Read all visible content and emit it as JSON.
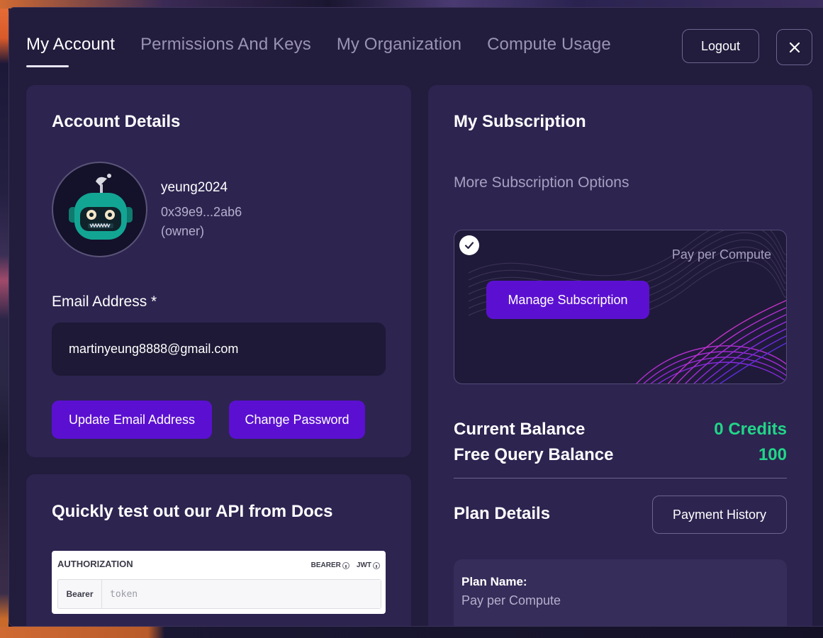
{
  "tabs": [
    {
      "label": "My Account",
      "active": true
    },
    {
      "label": "Permissions And Keys",
      "active": false
    },
    {
      "label": "My Organization",
      "active": false
    },
    {
      "label": "Compute Usage",
      "active": false
    }
  ],
  "header": {
    "logout_label": "Logout",
    "close_icon": "close-icon"
  },
  "account": {
    "title": "Account Details",
    "avatar_icon": "robot-avatar-icon",
    "username": "yeung2024",
    "address": "0x39e9...2ab6",
    "role": "(owner)",
    "email_label": "Email Address *",
    "email_value": "martinyeung8888@gmail.com",
    "update_email_label": "Update Email Address",
    "change_password_label": "Change Password"
  },
  "api_test": {
    "title": "Quickly test out our API from Docs",
    "auth_title": "AUTHORIZATION",
    "tags": [
      "BEARER",
      "JWT"
    ],
    "scheme": "Bearer",
    "token_placeholder": "token"
  },
  "subscription": {
    "title": "My Subscription",
    "more_options": "More Subscription Options",
    "plan_tile_name": "Pay per Compute",
    "manage_label": "Manage Subscription",
    "current_balance_label": "Current Balance",
    "current_balance_value": "0 Credits",
    "free_query_label": "Free Query Balance",
    "free_query_value": "100",
    "plan_details_title": "Plan Details",
    "payment_history_label": "Payment History",
    "plan_name_label": "Plan Name:",
    "plan_name_value": "Pay per Compute"
  },
  "colors": {
    "accent": "#5b10d1",
    "balance_green": "#22d688",
    "card_bg": "#2d2450",
    "modal_bg": "#221c3d"
  }
}
